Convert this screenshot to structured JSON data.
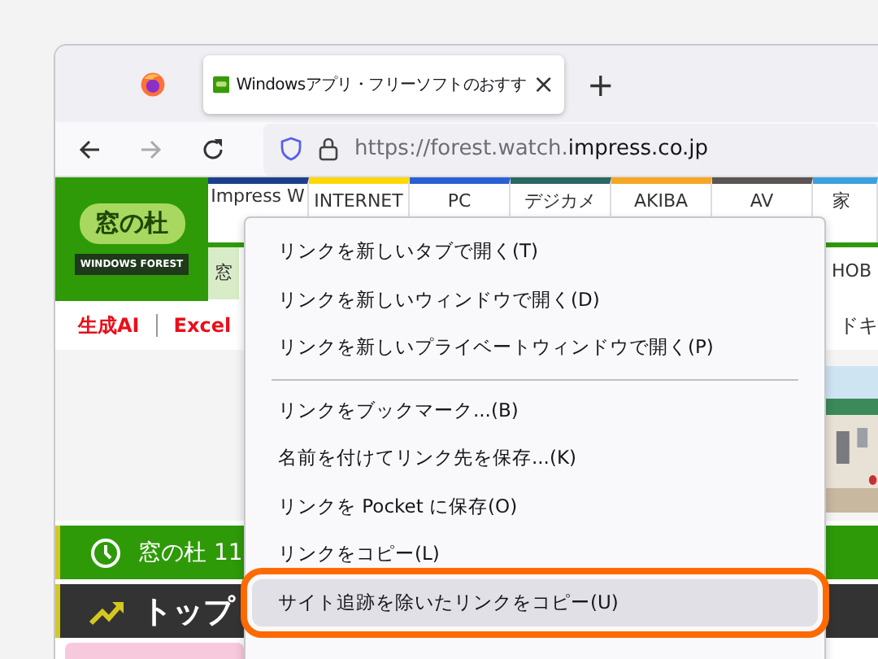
{
  "tab": {
    "title": "Windowsアプリ・フリーソフトのおすす",
    "close": "×",
    "new_tab": "+"
  },
  "address": {
    "url_host_prefix": "https://forest.watch.",
    "url_domain": "impress.co.jp"
  },
  "site": {
    "logo_title": "窓の杜",
    "logo_subtitle": "WINDOWS FOREST",
    "nav": [
      {
        "label": "Impress W",
        "color": "#1c3f8c"
      },
      {
        "label": "INTERNET",
        "color": "#ffd800"
      },
      {
        "label": "PC",
        "color": "#2a5fd6"
      },
      {
        "label": "デジカメ",
        "color": "#2c6660"
      },
      {
        "label": "AKIBA",
        "color": "#f5a623"
      },
      {
        "label": "AV",
        "color": "#5a5454"
      },
      {
        "label": "家",
        "color": "#3aa0e0"
      }
    ],
    "subnav": [
      {
        "label": "窓"
      },
      {
        "label": "HOB"
      }
    ],
    "topics": [
      {
        "label": "生成AI"
      },
      {
        "label": "Excel"
      }
    ],
    "topic_right": "ドキ",
    "news_bar": "窓の杜 11",
    "ranking_bar": "トップ"
  },
  "context_menu": [
    {
      "kind": "item",
      "label": "リンクを新しいタブで開く(T)",
      "highlighted": false
    },
    {
      "kind": "item",
      "label": "リンクを新しいウィンドウで開く(D)",
      "highlighted": false
    },
    {
      "kind": "item",
      "label": "リンクを新しいプライベートウィンドウで開く(P)",
      "highlighted": false
    },
    {
      "kind": "separator"
    },
    {
      "kind": "item",
      "label": "リンクをブックマーク...(B)",
      "highlighted": false
    },
    {
      "kind": "item",
      "label": "名前を付けてリンク先を保存...(K)",
      "highlighted": false
    },
    {
      "kind": "item",
      "label": "リンクを Pocket に保存(O)",
      "highlighted": false
    },
    {
      "kind": "item",
      "label": "リンクをコピー(L)",
      "highlighted": false
    },
    {
      "kind": "item",
      "label": "サイト追跡を除いたリンクをコピー(U)",
      "highlighted": true
    }
  ]
}
